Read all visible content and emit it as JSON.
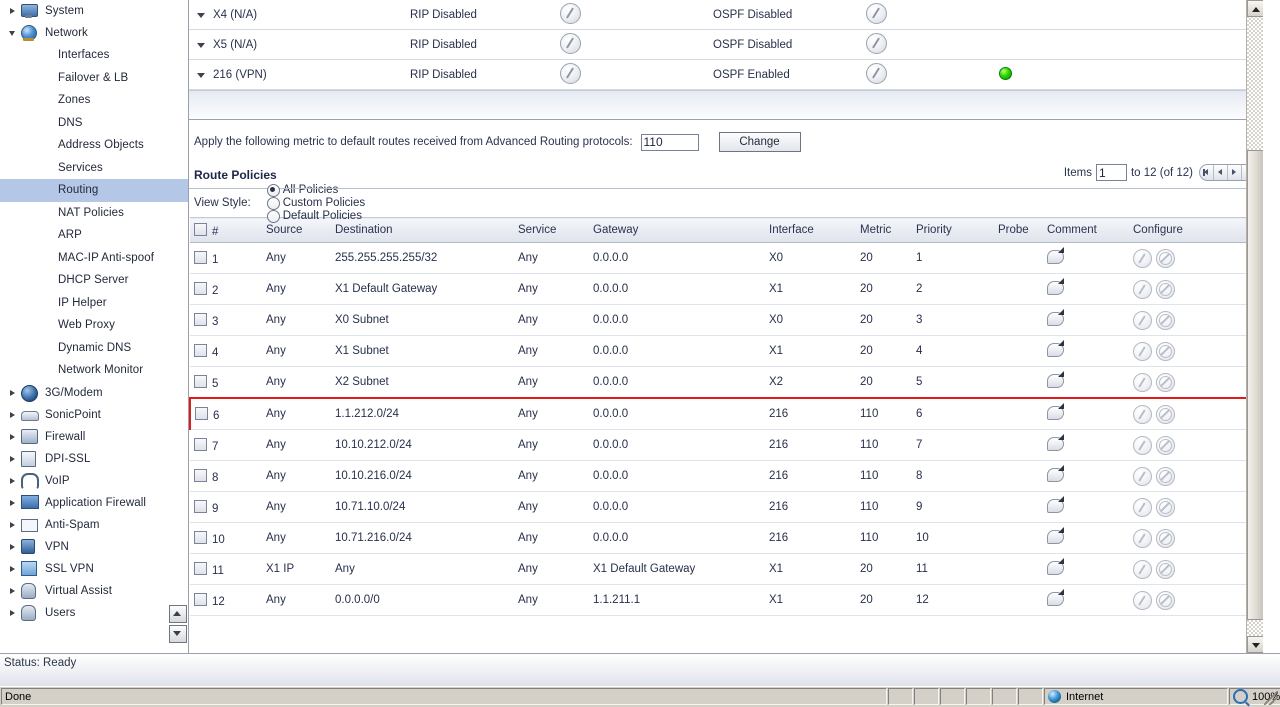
{
  "sidebar": {
    "items": [
      {
        "label": "System",
        "type": "group",
        "icon": "monitor-icon",
        "expanded": false,
        "selected": false
      },
      {
        "label": "Network",
        "type": "group",
        "icon": "globe-icon",
        "expanded": true,
        "selected": false
      },
      {
        "label": "Interfaces",
        "type": "leaf",
        "selected": false
      },
      {
        "label": "Failover & LB",
        "type": "leaf",
        "selected": false
      },
      {
        "label": "Zones",
        "type": "leaf",
        "selected": false
      },
      {
        "label": "DNS",
        "type": "leaf",
        "selected": false
      },
      {
        "label": "Address Objects",
        "type": "leaf",
        "selected": false
      },
      {
        "label": "Services",
        "type": "leaf",
        "selected": false
      },
      {
        "label": "Routing",
        "type": "leaf",
        "selected": true
      },
      {
        "label": "NAT Policies",
        "type": "leaf",
        "selected": false
      },
      {
        "label": "ARP",
        "type": "leaf",
        "selected": false
      },
      {
        "label": "MAC-IP Anti-spoof",
        "type": "leaf",
        "selected": false
      },
      {
        "label": "DHCP Server",
        "type": "leaf",
        "selected": false
      },
      {
        "label": "IP Helper",
        "type": "leaf",
        "selected": false
      },
      {
        "label": "Web Proxy",
        "type": "leaf",
        "selected": false
      },
      {
        "label": "Dynamic DNS",
        "type": "leaf",
        "selected": false
      },
      {
        "label": "Network Monitor",
        "type": "leaf",
        "selected": false
      },
      {
        "label": "3G/Modem",
        "type": "group",
        "icon": "modem-icon",
        "expanded": false,
        "selected": false
      },
      {
        "label": "SonicPoint",
        "type": "group",
        "icon": "sonicpoint-icon",
        "expanded": false,
        "selected": false
      },
      {
        "label": "Firewall",
        "type": "group",
        "icon": "firewall-icon",
        "expanded": false,
        "selected": false
      },
      {
        "label": "DPI-SSL",
        "type": "group",
        "icon": "dpi-ssl-icon",
        "expanded": false,
        "selected": false
      },
      {
        "label": "VoIP",
        "type": "group",
        "icon": "headset-icon",
        "expanded": false,
        "selected": false
      },
      {
        "label": "Application Firewall",
        "type": "group",
        "icon": "app-firewall-icon",
        "expanded": false,
        "selected": false
      },
      {
        "label": "Anti-Spam",
        "type": "group",
        "icon": "mail-block-icon",
        "expanded": false,
        "selected": false
      },
      {
        "label": "VPN",
        "type": "group",
        "icon": "lock-icon",
        "expanded": false,
        "selected": false
      },
      {
        "label": "SSL VPN",
        "type": "group",
        "icon": "ssl-vpn-icon",
        "expanded": false,
        "selected": false
      },
      {
        "label": "Virtual Assist",
        "type": "group",
        "icon": "user-assist-icon",
        "expanded": false,
        "selected": false
      },
      {
        "label": "Users",
        "type": "group",
        "icon": "users-icon",
        "expanded": false,
        "selected": false
      }
    ]
  },
  "interface_rows": [
    {
      "name": "X4 (N/A)",
      "rip": "RIP Disabled",
      "ospf": "OSPF Disabled",
      "led": false
    },
    {
      "name": "X5 (N/A)",
      "rip": "RIP Disabled",
      "ospf": "OSPF Disabled",
      "led": false
    },
    {
      "name": "216 (VPN)",
      "rip": "RIP Disabled",
      "ospf": "OSPF Enabled",
      "led": true
    }
  ],
  "metric_bar": {
    "label": "Apply the following metric to default routes received from Advanced Routing protocols:",
    "value": "110",
    "button_label": "Change"
  },
  "section": {
    "title": "Route Policies",
    "pager": {
      "items_label": "Items",
      "items_value": "1",
      "range_label": "to 12 (of 12)"
    }
  },
  "view_style": {
    "label": "View Style:",
    "options": [
      {
        "label": "All Policies",
        "checked": true
      },
      {
        "label": "Custom Policies",
        "checked": false
      },
      {
        "label": "Default Policies",
        "checked": false
      }
    ]
  },
  "policy_table": {
    "columns": [
      "#",
      "Source",
      "Destination",
      "Service",
      "Gateway",
      "Interface",
      "Metric",
      "Priority",
      "Probe",
      "Comment",
      "Configure"
    ],
    "rows": [
      {
        "num": "1",
        "source": "Any",
        "destination": "255.255.255.255/32",
        "service": "Any",
        "gateway": "0.0.0.0",
        "interface": "X0",
        "metric": "20",
        "priority": "1",
        "probe": "",
        "highlighted": false
      },
      {
        "num": "2",
        "source": "Any",
        "destination": "X1 Default Gateway",
        "service": "Any",
        "gateway": "0.0.0.0",
        "interface": "X1",
        "metric": "20",
        "priority": "2",
        "probe": "",
        "highlighted": false
      },
      {
        "num": "3",
        "source": "Any",
        "destination": "X0 Subnet",
        "service": "Any",
        "gateway": "0.0.0.0",
        "interface": "X0",
        "metric": "20",
        "priority": "3",
        "probe": "",
        "highlighted": false
      },
      {
        "num": "4",
        "source": "Any",
        "destination": "X1 Subnet",
        "service": "Any",
        "gateway": "0.0.0.0",
        "interface": "X1",
        "metric": "20",
        "priority": "4",
        "probe": "",
        "highlighted": false
      },
      {
        "num": "5",
        "source": "Any",
        "destination": "X2 Subnet",
        "service": "Any",
        "gateway": "0.0.0.0",
        "interface": "X2",
        "metric": "20",
        "priority": "5",
        "probe": "",
        "highlighted": false
      },
      {
        "num": "6",
        "source": "Any",
        "destination": "1.1.212.0/24",
        "service": "Any",
        "gateway": "0.0.0.0",
        "interface": "216",
        "metric": "110",
        "priority": "6",
        "probe": "",
        "highlighted": true
      },
      {
        "num": "7",
        "source": "Any",
        "destination": "10.10.212.0/24",
        "service": "Any",
        "gateway": "0.0.0.0",
        "interface": "216",
        "metric": "110",
        "priority": "7",
        "probe": "",
        "highlighted": false
      },
      {
        "num": "8",
        "source": "Any",
        "destination": "10.10.216.0/24",
        "service": "Any",
        "gateway": "0.0.0.0",
        "interface": "216",
        "metric": "110",
        "priority": "8",
        "probe": "",
        "highlighted": false
      },
      {
        "num": "9",
        "source": "Any",
        "destination": "10.71.10.0/24",
        "service": "Any",
        "gateway": "0.0.0.0",
        "interface": "216",
        "metric": "110",
        "priority": "9",
        "probe": "",
        "highlighted": false
      },
      {
        "num": "10",
        "source": "Any",
        "destination": "10.71.216.0/24",
        "service": "Any",
        "gateway": "0.0.0.0",
        "interface": "216",
        "metric": "110",
        "priority": "10",
        "probe": "",
        "highlighted": false
      },
      {
        "num": "11",
        "source": "X1 IP",
        "destination": "Any",
        "service": "Any",
        "gateway": "X1 Default Gateway",
        "interface": "X1",
        "metric": "20",
        "priority": "11",
        "probe": "",
        "highlighted": false
      },
      {
        "num": "12",
        "source": "Any",
        "destination": "0.0.0.0/0",
        "service": "Any",
        "gateway": "1.1.211.1",
        "interface": "X1",
        "metric": "20",
        "priority": "12",
        "probe": "",
        "highlighted": false
      }
    ]
  },
  "status_bar": {
    "text": "Status: Ready"
  },
  "browser_bar": {
    "done_label": "Done",
    "zone_label": "Internet",
    "zoom_label": "100%"
  },
  "colors": {
    "selection": "#b5c7e7",
    "highlight_outline": "#e01b1b",
    "led_green": "#2bd800",
    "header_gradient_top": "#f4f6fa"
  }
}
